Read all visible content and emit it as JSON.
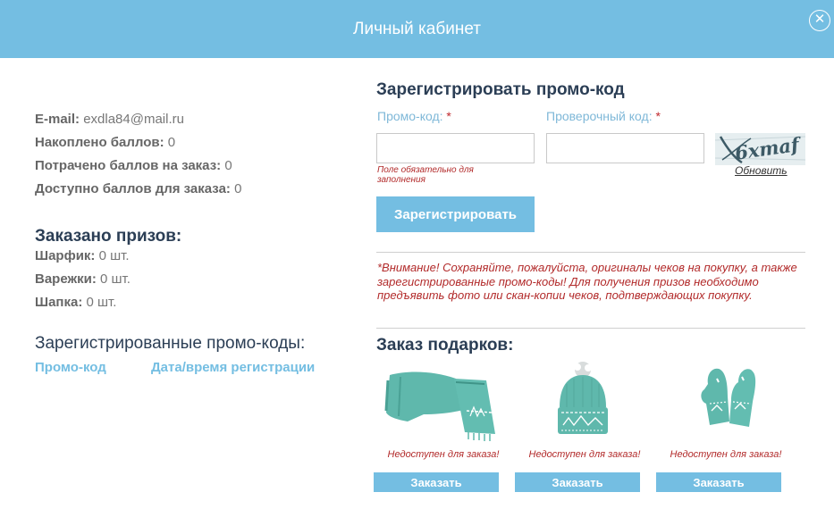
{
  "header": {
    "title": "Личный кабинет",
    "close_glyph": "✕"
  },
  "account": {
    "email_label": "E-mail:",
    "email_value": "exdla84@mail.ru",
    "earned_label": "Накоплено баллов:",
    "earned_value": "0",
    "spent_label": "Потрачено баллов на заказ:",
    "spent_value": "0",
    "available_label": "Доступно баллов для заказа:",
    "available_value": "0"
  },
  "ordered": {
    "title": "Заказано призов:",
    "items": [
      {
        "label": "Шарфик:",
        "value": "0 шт."
      },
      {
        "label": "Варежки:",
        "value": "0 шт."
      },
      {
        "label": "Шапка:",
        "value": "0 шт."
      }
    ]
  },
  "registered_codes": {
    "title": "Зарегистрированные промо-коды:",
    "col_code": "Промо-код",
    "col_date": "Дата/время регистрации"
  },
  "register": {
    "title": "Зарегистрировать промо-код",
    "promo_label": "Промо-код:",
    "check_label": "Проверочный код:",
    "required_mark": "*",
    "promo_value": "",
    "check_value": "",
    "error_hint": "Поле обязательно для заполнения",
    "captcha_text": "6xmaf",
    "refresh_label": "Обновить",
    "submit_label": "Зарегистрировать"
  },
  "notice": "*Внимание! Сохраняйте, пожалуйста, оригиналы чеков на покупку, а также зарегистрированные промо-коды! Для получения призов необходимо предъявить фото или скан-копии чеков, подтверждающих покупку.",
  "gifts": {
    "title": "Заказ подарков:",
    "items": [
      {
        "icon": "scarf-icon",
        "unavailable": "Недоступен для заказа!",
        "order_label": "Заказать"
      },
      {
        "icon": "hat-icon",
        "unavailable": "Недоступен для заказа!",
        "order_label": "Заказать"
      },
      {
        "icon": "mittens-icon",
        "unavailable": "Недоступен для заказа!",
        "order_label": "Заказать"
      }
    ]
  },
  "colors": {
    "accent": "#74bee2",
    "heading": "#2b3e55",
    "error": "#b22a2a",
    "product": "#5fb8ac"
  }
}
